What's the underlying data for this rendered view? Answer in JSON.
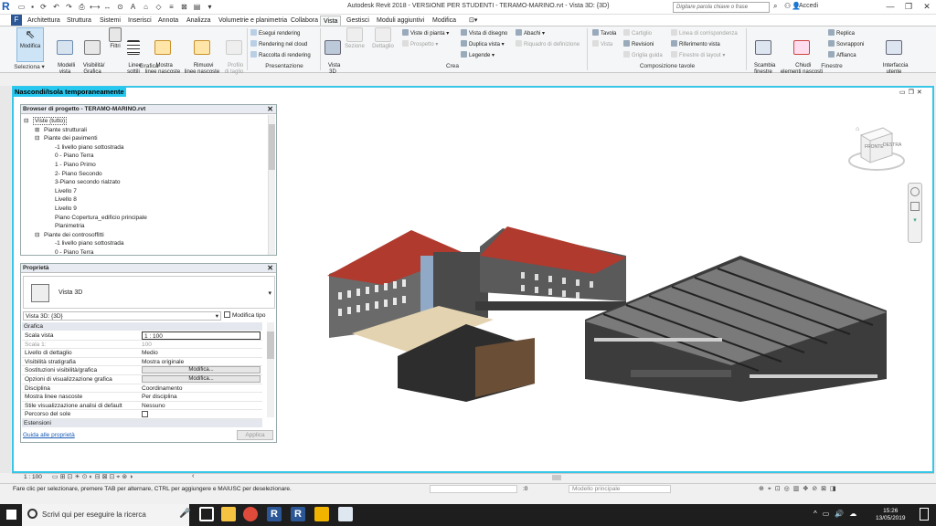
{
  "title_bar": {
    "logo": "R",
    "doc_title": "Autodesk Revit 2018 - VERSIONE PER STUDENTI -   TERAMO-MARINO.rvt - Vista 3D: {3D}",
    "search_placeholder": "Digitare parola chiave o frase",
    "user": "Accedi",
    "window_controls": [
      "—",
      "❐",
      "✕"
    ]
  },
  "tabs": {
    "file": "F",
    "items": [
      "Architettura",
      "Struttura",
      "Sistemi",
      "Inserisci",
      "Annota",
      "Analizza",
      "Volumetrie e planimetria",
      "Collabora",
      "Vista",
      "Gestisci",
      "Moduli aggiuntivi",
      "Modifica"
    ],
    "active": "Vista"
  },
  "ribbon": {
    "modifica": "Modifica",
    "seleziona": "Seleziona ▾",
    "modelli_vista": "Modelli\nvista",
    "visibilita": "Visibilità/\nGrafica",
    "filtri": "Filtri",
    "linee_sottili": "Linee\nsottili",
    "mostra_linee": "Mostra\nlinee nascoste",
    "rimuovi_linee": "Rimuovi\nlinee nascoste",
    "profilo": "Profilo\ndi taglio",
    "grafica_label": "Grafica",
    "esegui_rendering": "Esegui rendering",
    "rendering_cloud": "Rendering  nel cloud",
    "raccolta_rendering": "Raccolta  di rendering",
    "presentazione_label": "Presentazione",
    "vista_3d": "Vista\n3D",
    "sezione": "Sezione",
    "dettaglio": "Dettaglio",
    "viste_pianta": "Viste di pianta ▾",
    "prospetto": "Prospetto ▾",
    "vista_disegno": "Vista di disegno",
    "duplica_vista": "Duplica vista ▾",
    "legende": "Legende ▾",
    "abachi": "Abachi ▾",
    "riquadro": "Riquadro di definizione",
    "crea_label": "Crea",
    "tavola": "Tavola",
    "vista": "Vista",
    "cartiglio": "Cartiglio",
    "revisioni": "Revisioni",
    "griglia_guida": "Griglia guida",
    "linea_corrispondenza": "Linea di corrispondenza",
    "riferimento_vista": "Riferimento vista",
    "finestre_layout": "Finestre di layout ▾",
    "composizione_label": "Composizione tavole",
    "scambia_finestre": "Scambia\nfinestre",
    "chiudi_elementi": "Chiudi\nelementi nascosti",
    "replica": "Replica",
    "sovrapponi": "Sovrapponi",
    "affianca": "Affianca",
    "interfaccia_utente": "Interfaccia\nutente",
    "finestre_label": "Finestre"
  },
  "viewport": {
    "hide_label": "Nascondi/Isola temporaneamente",
    "navcube_face": "FRONTE",
    "navcube_side": "DESTRA"
  },
  "browser": {
    "title": "Browser di progetto - TERAMO-MARINO.rvt",
    "items": [
      {
        "text": "Viste (tutto)",
        "level": 0,
        "toggle": "⊟"
      },
      {
        "text": "Piante strutturali",
        "level": 1,
        "toggle": "⊞"
      },
      {
        "text": "Piante dei pavimenti",
        "level": 1,
        "toggle": "⊟"
      },
      {
        "text": "-1 livello piano sottostrada",
        "level": 2,
        "toggle": ""
      },
      {
        "text": "0 - Piano Terra",
        "level": 2,
        "toggle": ""
      },
      {
        "text": "1 - Piano Primo",
        "level": 2,
        "toggle": ""
      },
      {
        "text": "2- Piano Secondo",
        "level": 2,
        "toggle": ""
      },
      {
        "text": "3-Piano secondo rialzato",
        "level": 2,
        "toggle": ""
      },
      {
        "text": "Livello 7",
        "level": 2,
        "toggle": ""
      },
      {
        "text": "Livello 8",
        "level": 2,
        "toggle": ""
      },
      {
        "text": "Livello 9",
        "level": 2,
        "toggle": ""
      },
      {
        "text": "Piano Copertura_edificio principale",
        "level": 2,
        "toggle": ""
      },
      {
        "text": "Planimetria",
        "level": 2,
        "toggle": ""
      },
      {
        "text": "Piante dei controsoffitti",
        "level": 1,
        "toggle": "⊟"
      },
      {
        "text": "-1 livello piano sottostrada",
        "level": 2,
        "toggle": ""
      },
      {
        "text": "0 - Piano Terra",
        "level": 2,
        "toggle": ""
      }
    ]
  },
  "properties": {
    "title": "Proprietà",
    "type_name": "Vista 3D",
    "selector": "Vista 3D: {3D}",
    "edit_type": "Modifica tipo",
    "cat_grafica": "Grafica",
    "rows": [
      {
        "k": "Scala vista",
        "v": "1 : 100"
      },
      {
        "k": "Scala  1:",
        "v": "100"
      },
      {
        "k": "Livello di dettaglio",
        "v": "Medio"
      },
      {
        "k": "Visibilità stratigrafia",
        "v": "Mostra originale"
      },
      {
        "k": "Sostituzioni visibilità/grafica",
        "v": "Modifica..."
      },
      {
        "k": "Opzioni di visualizzazione grafica",
        "v": "Modifica..."
      },
      {
        "k": "Disciplina",
        "v": "Coordinamento"
      },
      {
        "k": "Mostra linee nascoste",
        "v": "Per disciplina"
      },
      {
        "k": "Stile visualizzazione analisi di default",
        "v": "Nessuno"
      },
      {
        "k": "Percorso del sole",
        "v": ""
      }
    ],
    "cat_estensioni": "Estensioni",
    "help_link": "Guida alle proprietà",
    "apply": "Applica"
  },
  "view_bar": {
    "scale": "1 : 100"
  },
  "status_bar": {
    "message": "Fare clic per selezionare, premere TAB per alternare, CTRL per aggiungere e MAIUSC per deselezionare.",
    "workset": ":0",
    "model": "Modello principale"
  },
  "taskbar": {
    "search": "Scrivi qui per eseguire la ricerca",
    "time": "15:26",
    "date": "13/05/2019"
  }
}
